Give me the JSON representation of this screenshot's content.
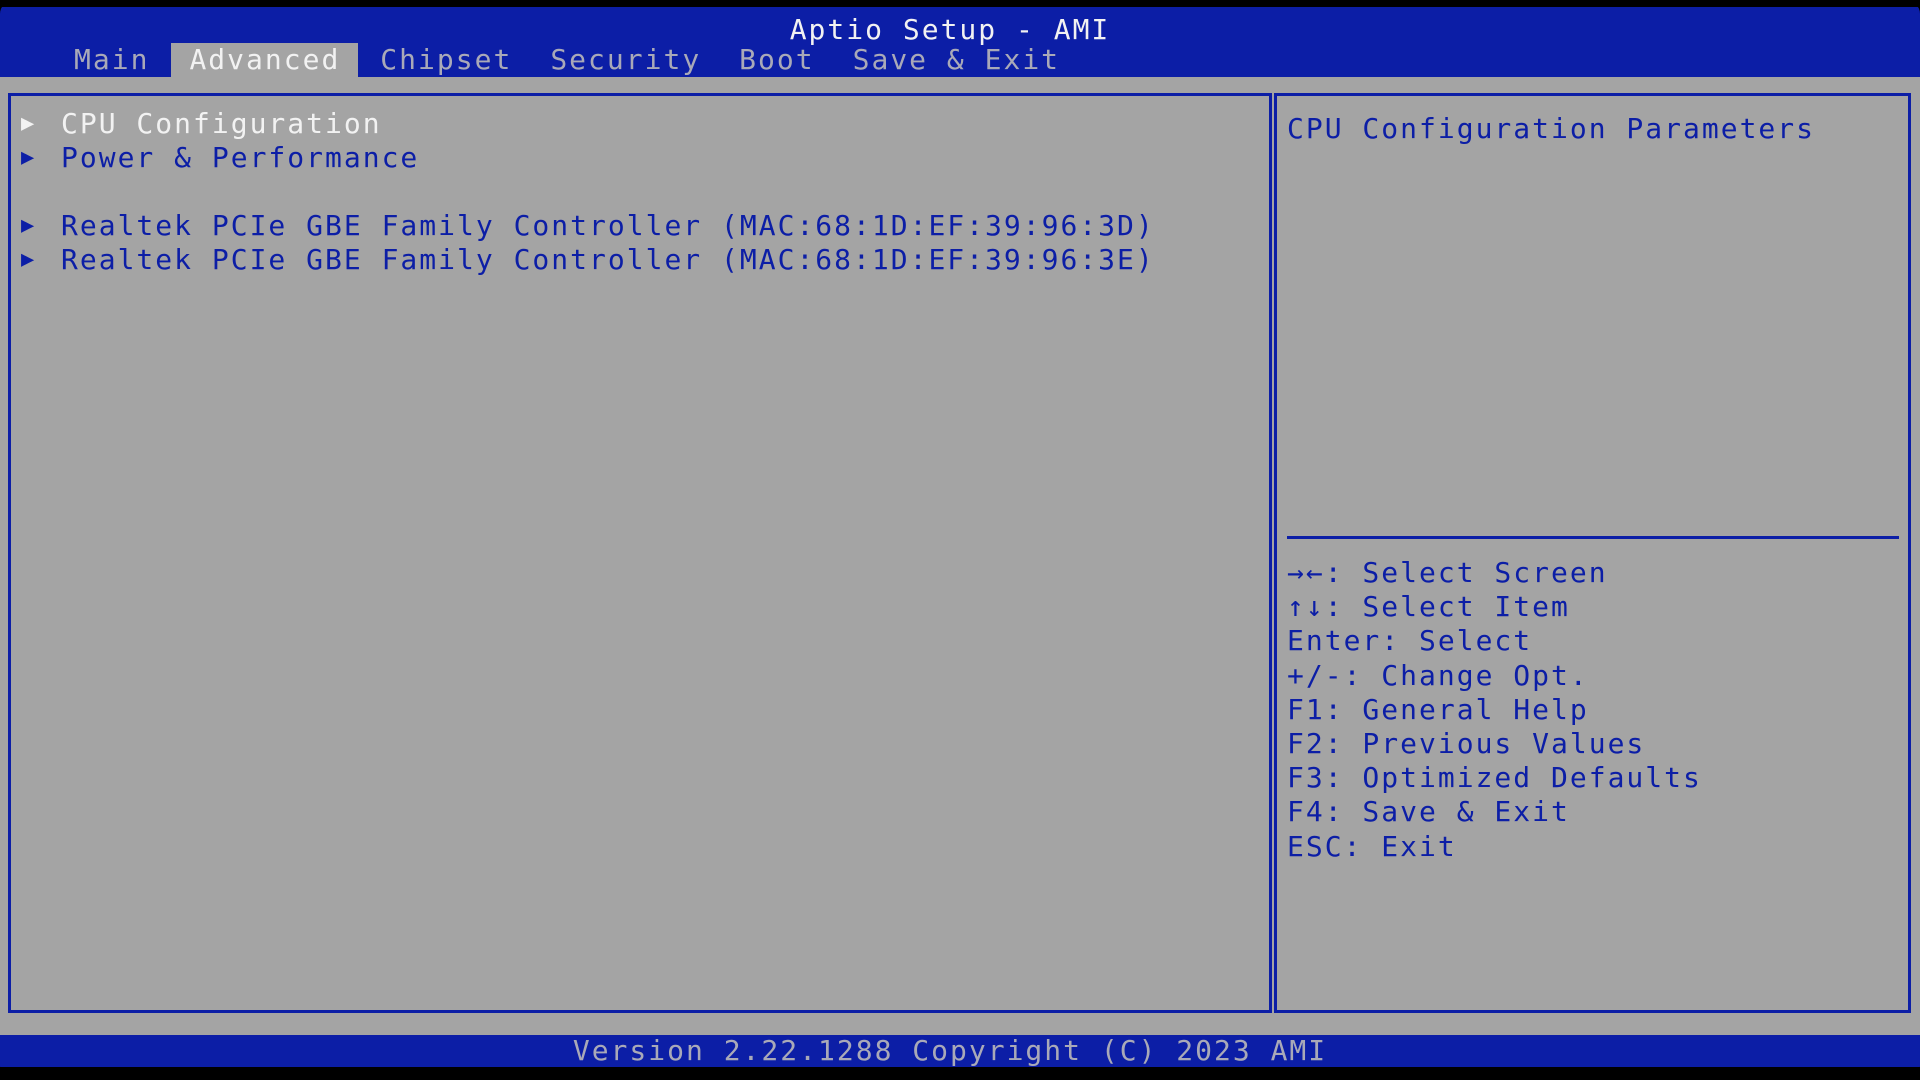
{
  "app": {
    "title": "Aptio Setup - AMI"
  },
  "tabs": [
    {
      "label": "Main"
    },
    {
      "label": "Advanced"
    },
    {
      "label": "Chipset"
    },
    {
      "label": "Security"
    },
    {
      "label": "Boot"
    },
    {
      "label": "Save & Exit"
    }
  ],
  "active_tab": "Advanced",
  "menu": {
    "arrow_glyph": "▶",
    "items": [
      {
        "label": "CPU Configuration"
      },
      {
        "label": "Power & Performance"
      },
      {
        "label": "Realtek PCIe GBE Family Controller (MAC:68:1D:EF:39:96:3D)"
      },
      {
        "label": "Realtek PCIe GBE Family Controller (MAC:68:1D:EF:39:96:3E)"
      }
    ],
    "selected_item": "CPU Configuration"
  },
  "help": {
    "description": "CPU Configuration Parameters",
    "keys": [
      "→←: Select Screen",
      "↑↓: Select Item",
      "Enter: Select",
      "+/-: Change Opt.",
      "F1: General Help",
      "F2: Previous Values",
      "F3: Optimized Defaults",
      "F4: Save & Exit",
      "ESC: Exit"
    ]
  },
  "footer": {
    "text": "Version 2.22.1288 Copyright (C) 2023 AMI"
  },
  "colors": {
    "frame_blue": "#0c1ea6",
    "panel_gray": "#a4a4a4",
    "highlight_white": "#f2f2f2",
    "inactive_gray": "#a9a9b8"
  }
}
